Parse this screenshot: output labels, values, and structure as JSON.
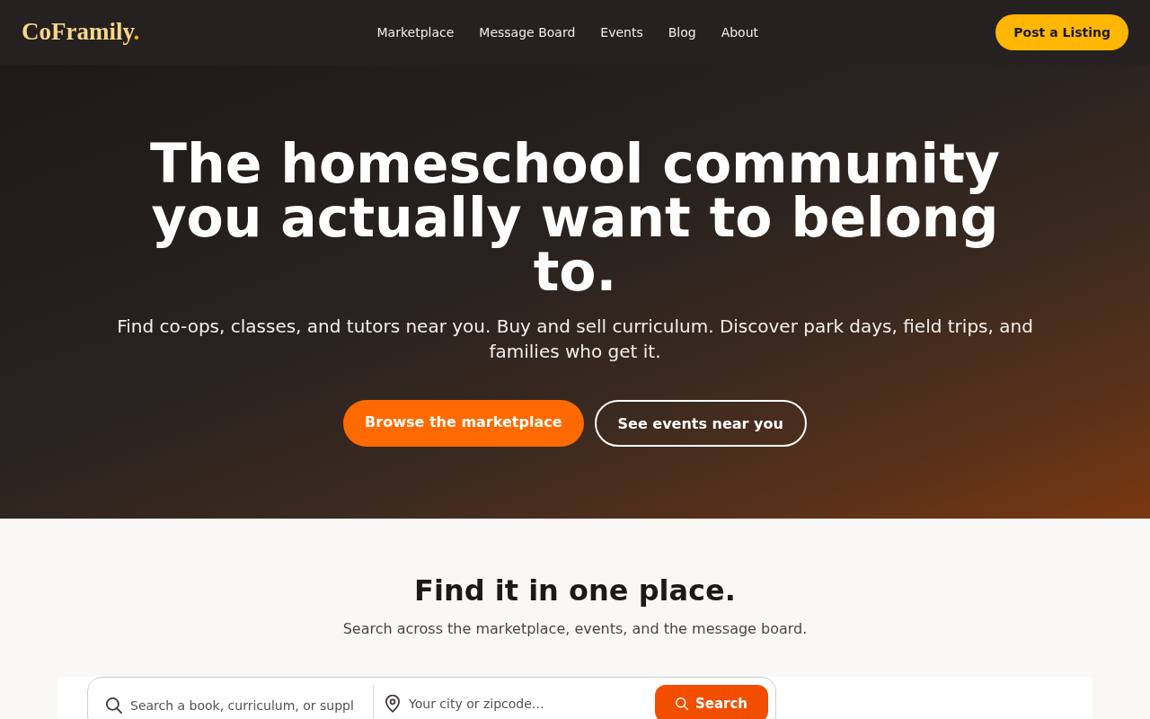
{
  "header": {
    "logo": {
      "text": "CoFramily",
      "accent": "."
    },
    "nav": [
      {
        "label": "Marketplace"
      },
      {
        "label": "Message Board"
      },
      {
        "label": "Events"
      },
      {
        "label": "Blog"
      },
      {
        "label": "About"
      }
    ],
    "cta": "Post a Listing"
  },
  "hero": {
    "title": "The homeschool community you actually want to belong to.",
    "subtitle": "Find co-ops, classes, and tutors near you. Buy and sell curriculum. Discover park days, field trips, and families who get it.",
    "buttons": [
      {
        "label": "Browse the marketplace",
        "kind": "primary"
      },
      {
        "label": "See events near you",
        "kind": "outline"
      }
    ]
  },
  "search_section": {
    "title": "Find it in one place.",
    "subtitle": "Search across the marketplace, events, and the message board.",
    "search_bar": {
      "query": {
        "placeholder": "Search a book, curriculum, or suppl"
      },
      "location": {
        "placeholder": "Your city or zipcode…"
      },
      "button": "Search"
    }
  }
}
